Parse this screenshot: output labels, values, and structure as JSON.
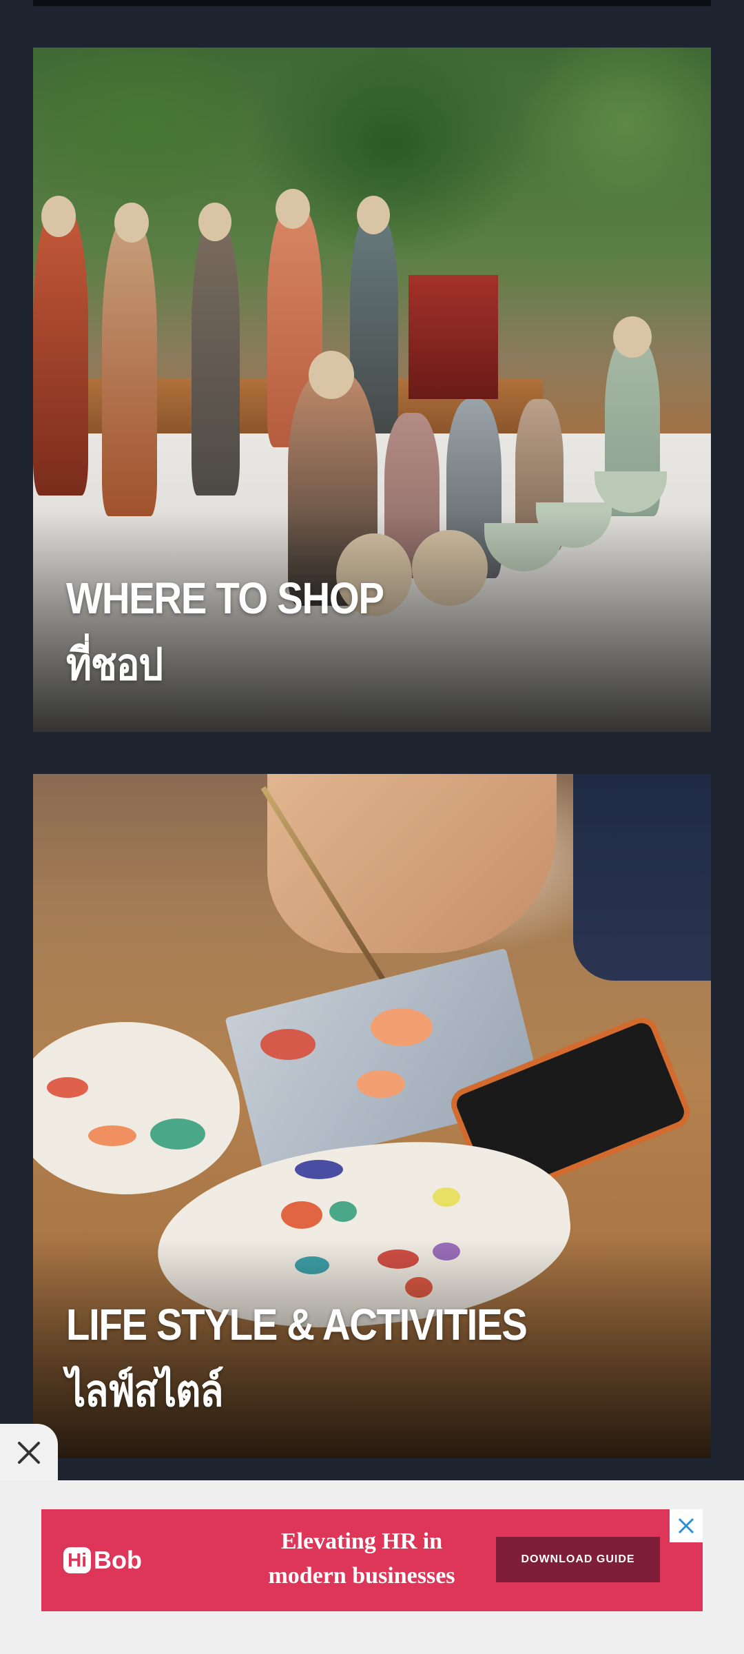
{
  "cards": [
    {
      "caption_en": "WHERE TO SHOP",
      "caption_th": "ที่ชอป"
    },
    {
      "caption_en": "LIFE STYLE & ACTIVITIES",
      "caption_th": "ไลฟ์สไตล์"
    }
  ],
  "floating_close": {
    "icon": "close-icon"
  },
  "ad": {
    "brand": "HiBob",
    "brand_hi": "Hi",
    "brand_rest": "Bob",
    "headline_line1": "Elevating HR in",
    "headline_line2": "modern businesses",
    "cta": "DOWNLOAD GUIDE",
    "close_icon": "close-icon",
    "colors": {
      "background": "#de3658",
      "cta_background": "#7e1e39",
      "bar_background": "#efefef"
    }
  },
  "colors": {
    "page_background": "#1e2530",
    "caption_text": "#ffffff"
  }
}
